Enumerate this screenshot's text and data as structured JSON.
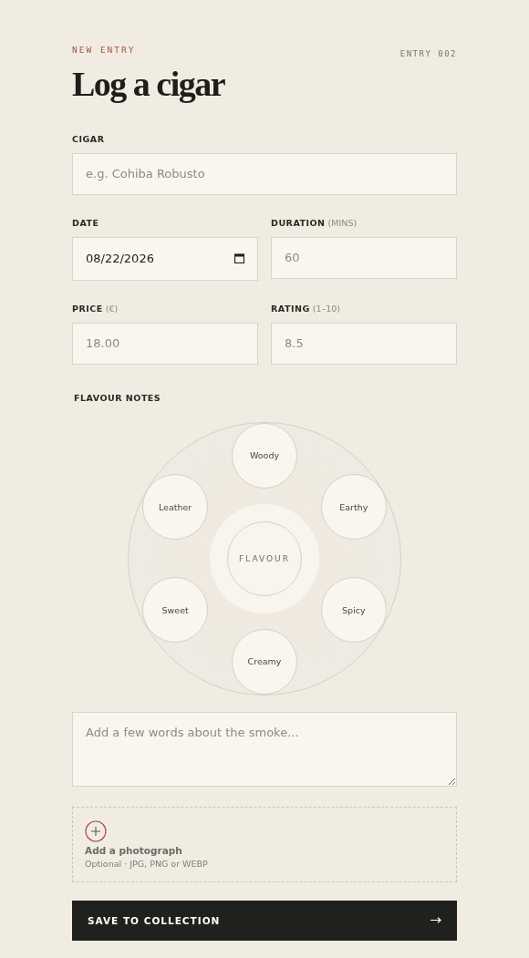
{
  "header": {
    "eyebrow": "NEW ENTRY",
    "entry_number": "ENTRY 002",
    "title": "Log a cigar"
  },
  "cigar": {
    "label": "CIGAR",
    "placeholder": "e.g. Cohiba Robusto"
  },
  "field_rows": [
    [
      {
        "kind": "date",
        "label": "DATE",
        "value": "08/22/2026"
      },
      {
        "kind": "text",
        "label": "DURATION",
        "hint": "(MINS)",
        "placeholder": "60"
      }
    ],
    [
      {
        "kind": "text",
        "label": "PRICE",
        "hint": "(€)",
        "placeholder": "18.00"
      },
      {
        "kind": "text",
        "label": "RATING",
        "hint": "(1–10)",
        "placeholder": "8.5"
      }
    ]
  ],
  "flavour_notes": {
    "label": "FLAVOUR NOTES",
    "center": "FLAVOUR",
    "notes": [
      {
        "label": "Woody",
        "selected": false
      },
      {
        "label": "Earthy",
        "selected": false
      },
      {
        "label": "Spicy",
        "selected": false
      },
      {
        "label": "Creamy",
        "selected": false
      },
      {
        "label": "Sweet",
        "selected": false
      },
      {
        "label": "Leather",
        "selected": false
      }
    ]
  },
  "notes_field": {
    "placeholder": "Add a few words about the smoke..."
  },
  "photo_upload": {
    "title": "Add a photograph",
    "subtitle": "Optional · JPG, PNG or WEBP"
  },
  "submit": {
    "label": "SAVE TO COLLECTION"
  }
}
